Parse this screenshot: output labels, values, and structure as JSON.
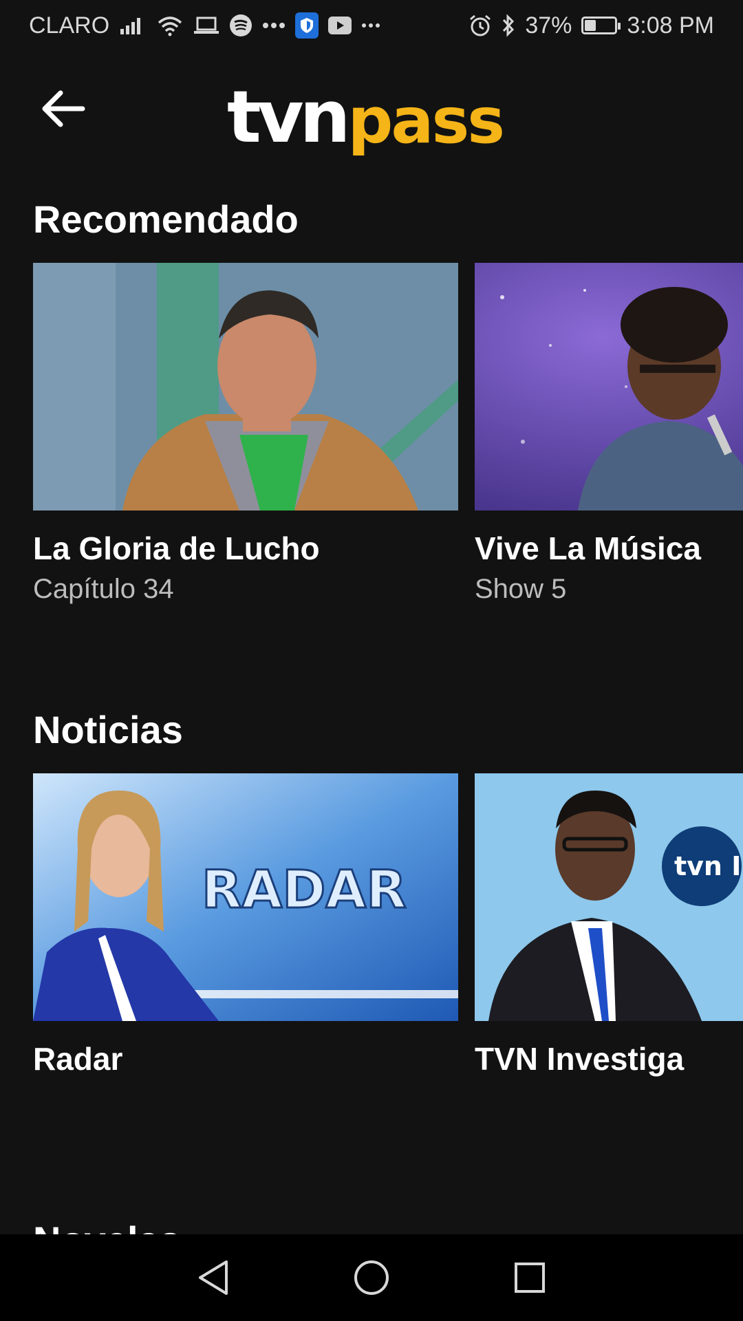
{
  "status_bar": {
    "carrier": "CLARO",
    "battery_percent": "37%",
    "battery_level": 0.37,
    "time": "3:08 PM",
    "left_icons": [
      "signal-icon",
      "wifi-icon",
      "laptop-icon",
      "spotify-icon",
      "dots-icon",
      "vpn-shield-icon",
      "youtube-icon",
      "more-icon"
    ],
    "right_icons": [
      "alarm-icon",
      "bluetooth-icon",
      "battery-icon"
    ]
  },
  "header": {
    "logo_part1": "tvn",
    "logo_part2": "pass",
    "back_icon": "back-arrow-icon",
    "brand_colors": {
      "tvn": "#ffffff",
      "pass": "#f5b417"
    }
  },
  "sections": [
    {
      "title": "Recomendado",
      "items": [
        {
          "title": "La Gloria de Lucho",
          "subtitle": "Capítulo 34"
        },
        {
          "title": "Vive La Música",
          "subtitle": "Show 5"
        }
      ]
    },
    {
      "title": "Noticias",
      "items": [
        {
          "title": "Radar",
          "subtitle": "",
          "thumb_text": "RADAR"
        },
        {
          "title": "TVN Investiga",
          "subtitle": "",
          "thumb_text": "tvn IN"
        }
      ]
    },
    {
      "title": "Novelas"
    }
  ],
  "nav_bar": {
    "icons": [
      "nav-back-icon",
      "nav-home-icon",
      "nav-recents-icon"
    ]
  },
  "colors": {
    "background": "#121212",
    "accent": "#f5b417",
    "subtitle": "#bdbdbd"
  }
}
